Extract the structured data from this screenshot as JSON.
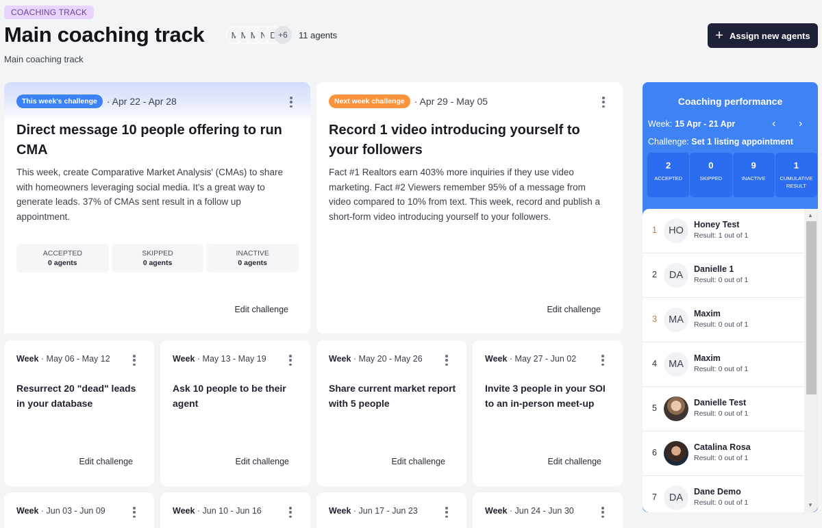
{
  "header": {
    "tag": "COACHING TRACK",
    "title": "Main coaching track",
    "subtitle": "Main coaching track",
    "avatars": [
      "M",
      "M",
      "M",
      "N",
      "D"
    ],
    "more_count": "+6",
    "agent_count": "11 agents",
    "assign_button": "Assign new agents",
    "assign_icon": "plus-icon"
  },
  "current_challenge": {
    "badge": "This week's challenge",
    "badge_color": "#3b82f6",
    "date_range": "· Apr 22 - Apr 28",
    "title": "Direct message 10 people offering to run CMA",
    "description": "This week, create Comparative Market Analysis' (CMAs) to share with homeowners leveraging social media. It's a great way to generate leads. 37% of CMAs sent result in a follow up appointment.",
    "stats": [
      {
        "label": "ACCEPTED",
        "value": "0 agents"
      },
      {
        "label": "SKIPPED",
        "value": "0 agents"
      },
      {
        "label": "INACTIVE",
        "value": "0 agents"
      }
    ],
    "edit_label": "Edit challenge"
  },
  "next_challenge": {
    "badge": "Next week challenge",
    "badge_color": "#fb923c",
    "date_range": "· Apr 29 - May 05",
    "title": "Record 1 video introducing yourself to your followers",
    "description": "Fact #1 Realtors earn 403% more inquiries if they use video marketing. Fact #2 Viewers remember 95% of a message from video compared to 10% from text. This week, record and publish a short-form video introducing yourself to your followers.",
    "edit_label": "Edit challenge"
  },
  "weeks": [
    {
      "label": "Week",
      "range": "· May 06 - May 12",
      "title": "Resurrect 20 \"dead\" leads in your database",
      "edit_label": "Edit challenge"
    },
    {
      "label": "Week",
      "range": "· May 13 - May 19",
      "title": "Ask 10 people to be their agent",
      "edit_label": "Edit challenge"
    },
    {
      "label": "Week",
      "range": "· May 20 - May 26",
      "title": "Share current market report with 5 people",
      "edit_label": "Edit challenge"
    },
    {
      "label": "Week",
      "range": "· May 27 - Jun 02",
      "title": "Invite 3 people in your SOI to an in-person meet-up",
      "edit_label": "Edit challenge"
    },
    {
      "label": "Week",
      "range": "· Jun 03 - Jun 09"
    },
    {
      "label": "Week",
      "range": "· Jun 10 - Jun 16"
    },
    {
      "label": "Week",
      "range": "· Jun 17 - Jun 23"
    },
    {
      "label": "Week",
      "range": "· Jun 24 - Jun 30"
    }
  ],
  "performance": {
    "title": "Coaching performance",
    "week_label": "Week:",
    "week_value": "15 Apr - 21 Apr",
    "prev_icon": "‹",
    "next_icon": "›",
    "challenge_label": "Challenge:",
    "challenge_value": "Set 1 listing appointment",
    "stats": [
      {
        "value": "2",
        "label": "ACCEPTED"
      },
      {
        "value": "0",
        "label": "SKIPPED"
      },
      {
        "value": "9",
        "label": "INACTIVE"
      },
      {
        "value": "1",
        "label": "CUMULATIVE RESULT"
      }
    ],
    "leaderboard": [
      {
        "rank": "1",
        "initials": "HO",
        "name": "Honey Test",
        "result": "Result: 1 out of 1",
        "medal": true
      },
      {
        "rank": "2",
        "initials": "DA",
        "name": "Danielle 1",
        "result": "Result: 0 out of 1",
        "medal": false
      },
      {
        "rank": "3",
        "initials": "MA",
        "name": "Maxim",
        "result": "Result: 0 out of 1",
        "medal": true
      },
      {
        "rank": "4",
        "initials": "MA",
        "name": "Maxim",
        "result": "Result: 0 out of 1",
        "medal": false
      },
      {
        "rank": "5",
        "initials": "",
        "name": "Danielle Test",
        "result": "Result: 0 out of 1",
        "medal": false,
        "photo": "photo1"
      },
      {
        "rank": "6",
        "initials": "",
        "name": "Catalina Rosa",
        "result": "Result: 0 out of 1",
        "medal": false,
        "photo": "photo2"
      },
      {
        "rank": "7",
        "initials": "DA",
        "name": "Dane Demo",
        "result": "Result: 0 out of 1",
        "medal": false
      }
    ]
  }
}
